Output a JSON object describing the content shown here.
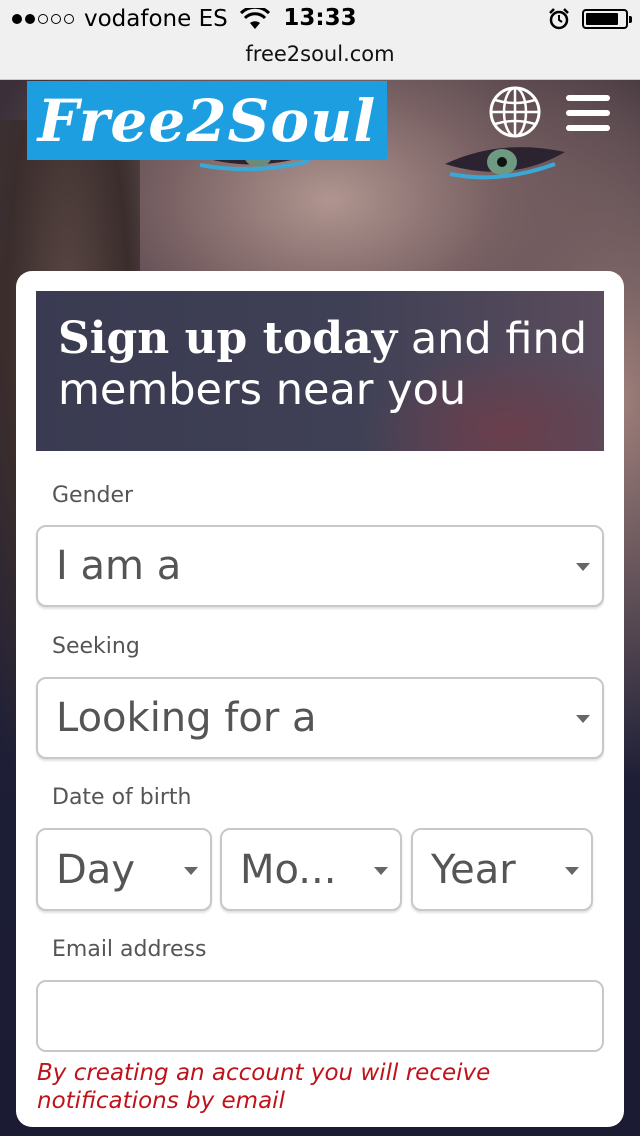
{
  "status_bar": {
    "carrier": "vodafone ES",
    "time": "13:33",
    "signal_bars_filled": 2,
    "signal_bars_total": 5,
    "icons": [
      "wifi-icon",
      "alarm-icon",
      "battery-icon"
    ],
    "battery_level": 0.85
  },
  "browser": {
    "url": "free2soul.com"
  },
  "header": {
    "logo_text": "Free2Soul",
    "logo_color": "#1c9ee0",
    "icons": [
      "globe-icon",
      "hamburger-menu-icon"
    ]
  },
  "signup": {
    "headline_bold": "Sign up today",
    "headline_rest": " and find",
    "headline_line2": "members near you",
    "gender": {
      "label": "Gender",
      "value": "I am a"
    },
    "seeking": {
      "label": "Seeking",
      "value": "Looking for a"
    },
    "dob": {
      "label": "Date of birth",
      "day": "Day",
      "month": "Mo...",
      "year": "Year"
    },
    "email": {
      "label": "Email address",
      "value": ""
    },
    "notice": "By creating an account you will receive notifications by email",
    "notice_color": "#c0121b"
  }
}
